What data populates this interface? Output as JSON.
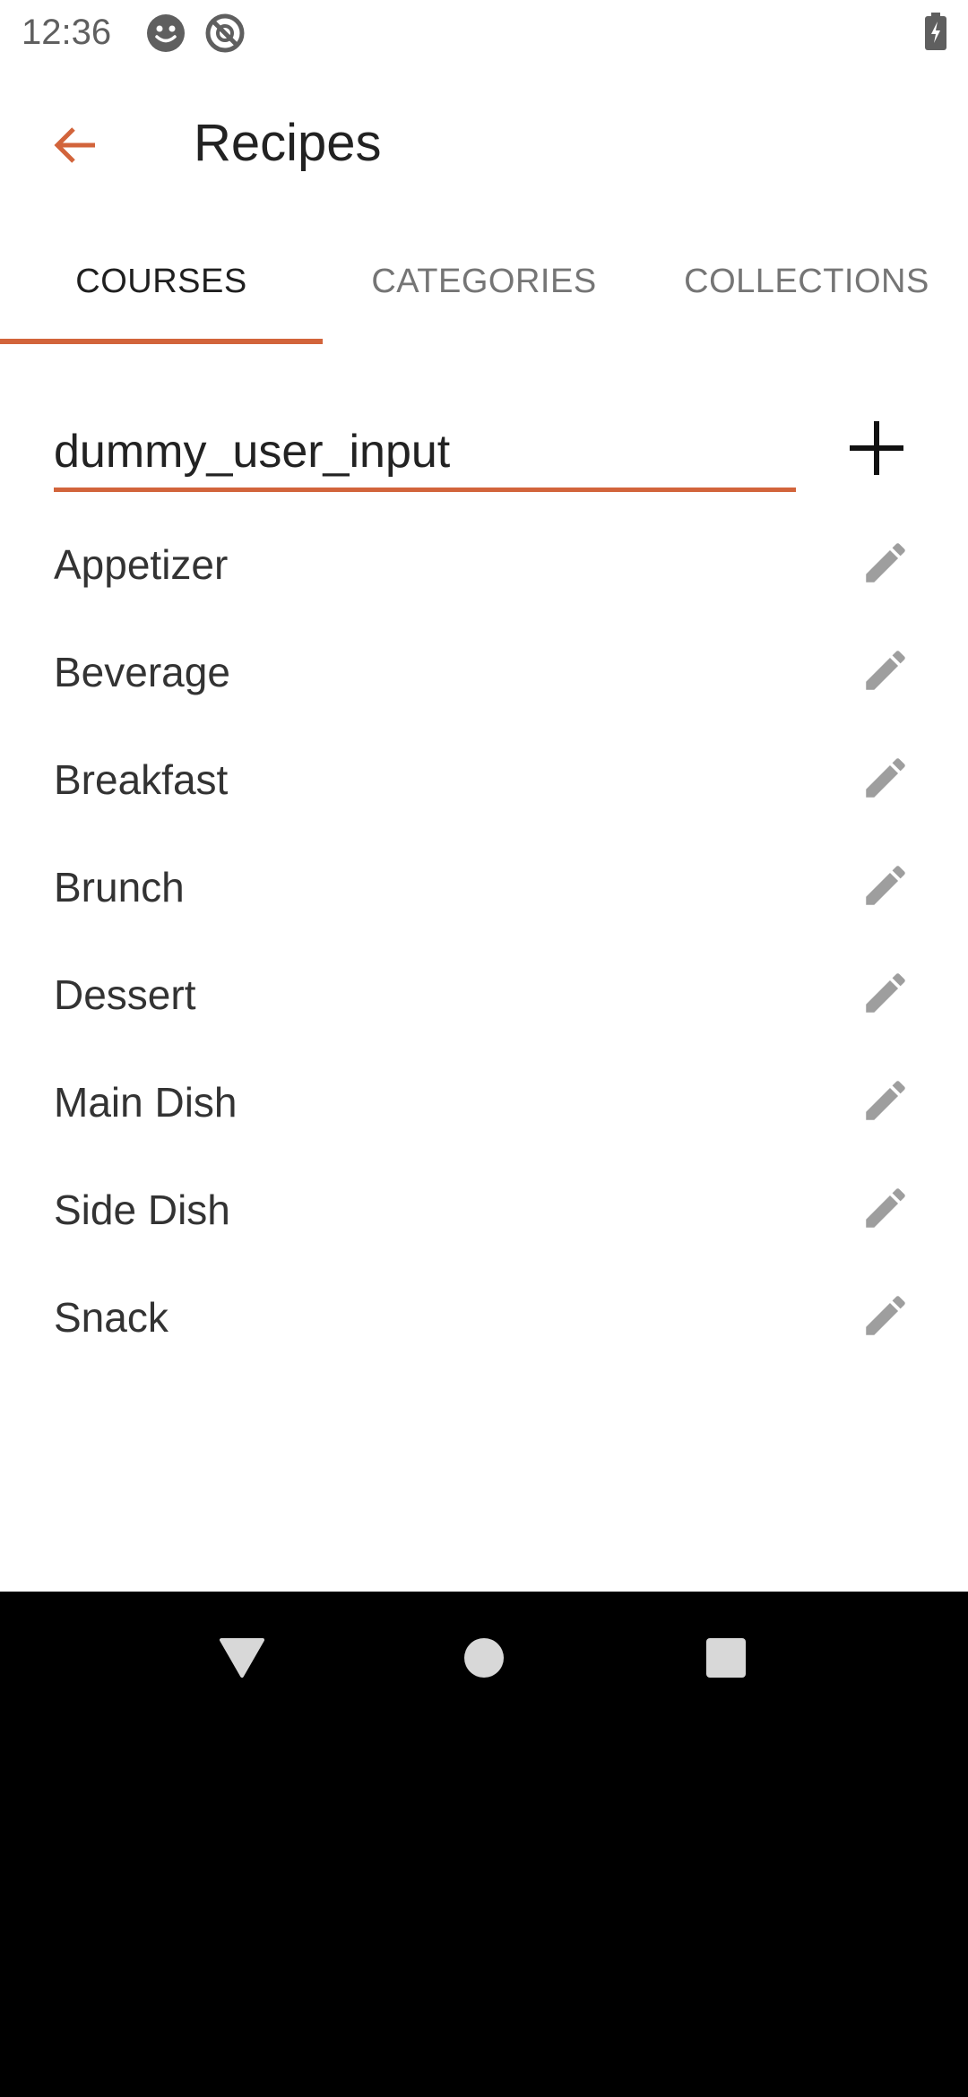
{
  "status_bar": {
    "time": "12:36",
    "icons": [
      "face-icon",
      "do-not-disturb-icon",
      "battery-charging-icon"
    ]
  },
  "app_bar": {
    "title": "Recipes",
    "back_icon": "arrow-back-icon"
  },
  "tabs": [
    {
      "label": "COURSES",
      "active": true
    },
    {
      "label": "CATEGORIES",
      "active": false
    },
    {
      "label": "COLLECTIONS",
      "active": false
    }
  ],
  "course_input": {
    "value": "dummy_user_input",
    "add_icon": "plus-icon"
  },
  "courses": [
    {
      "label": "Appetizer"
    },
    {
      "label": "Beverage"
    },
    {
      "label": "Breakfast"
    },
    {
      "label": "Brunch"
    },
    {
      "label": "Dessert"
    },
    {
      "label": "Main Dish"
    },
    {
      "label": "Side Dish"
    },
    {
      "label": "Snack"
    }
  ],
  "edit_icon": "pencil-icon",
  "nav_bar": {
    "buttons": [
      "back-triangle-icon",
      "home-circle-icon",
      "recents-square-icon"
    ]
  },
  "colors": {
    "accent": "#d2643b",
    "text_primary": "#222222",
    "icon_gray": "#9e9e9e"
  }
}
